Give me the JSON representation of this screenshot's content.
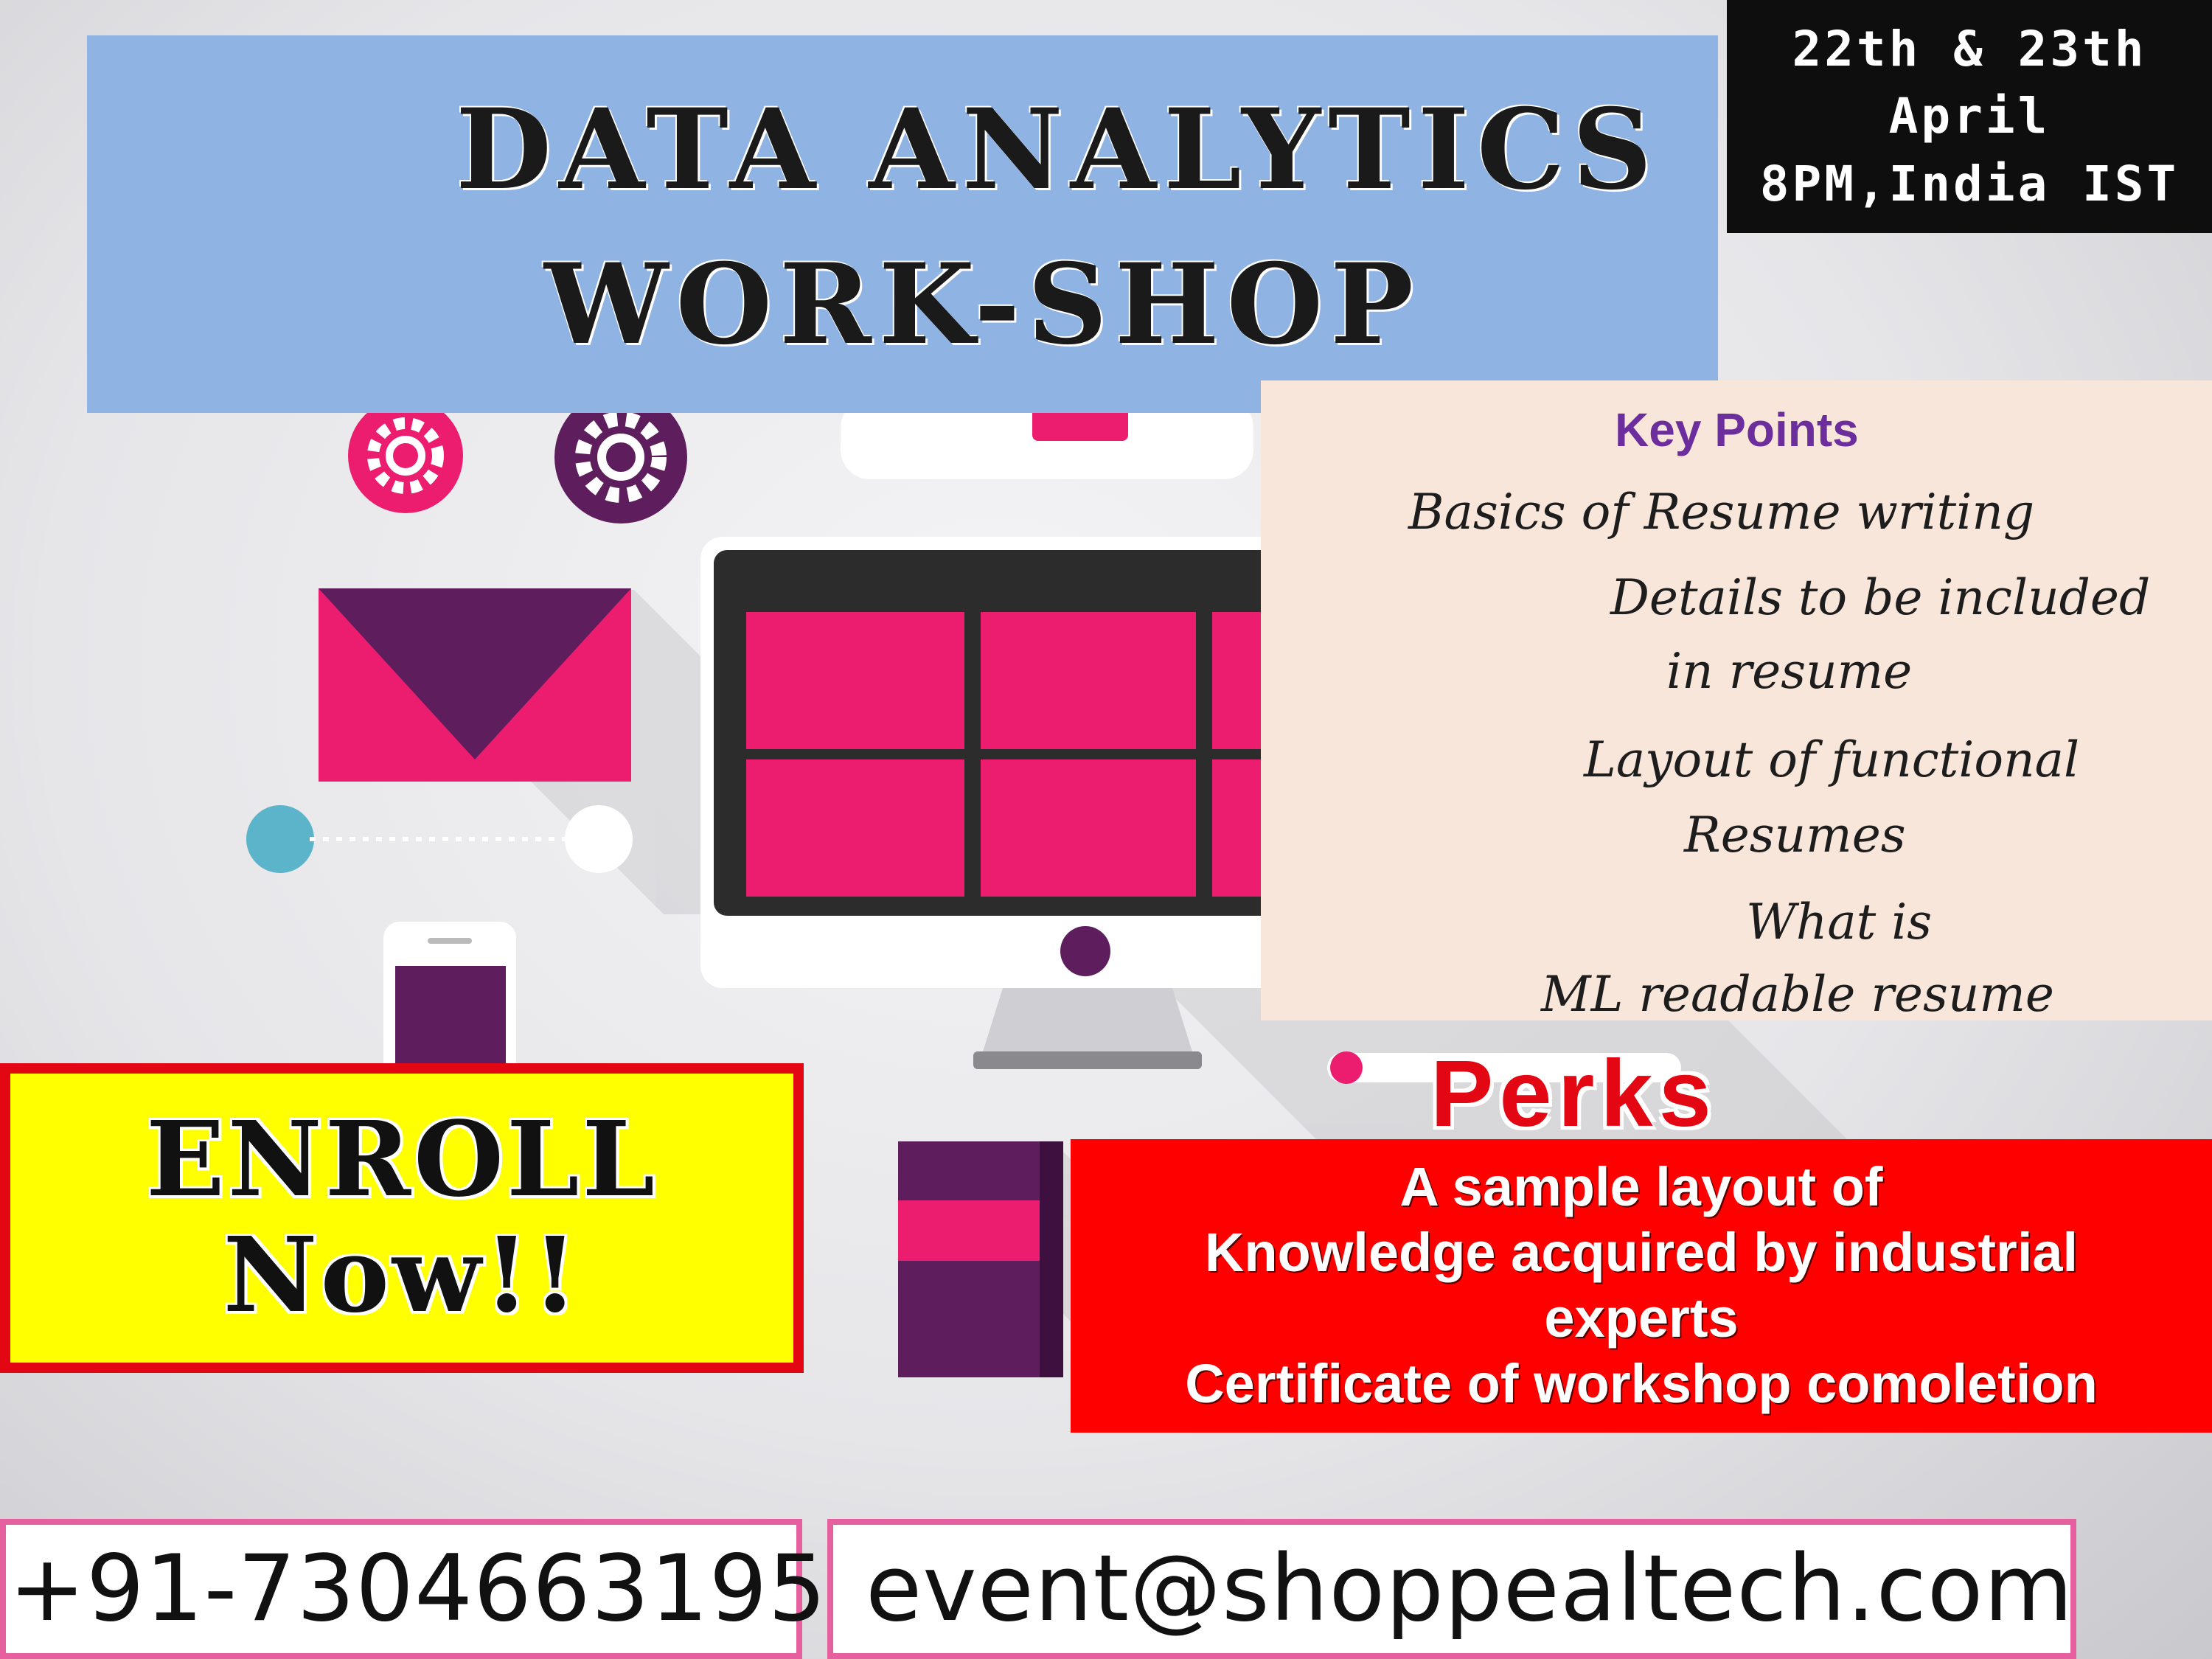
{
  "header": {
    "title_line1": "DATA ANALYTICS",
    "title_line2": "WORK-SHOP"
  },
  "schedule": {
    "dates": "22th & 23th",
    "month": "April",
    "time": "8PM,India IST"
  },
  "key_points": {
    "heading": "Key Points",
    "items": [
      "Basics of Resume writing",
      "Details to be included",
      "in resume",
      "Layout of functional",
      "Resumes",
      "What is",
      "ML readable resume"
    ]
  },
  "enroll": {
    "line1": "ENROLL",
    "line2": "Now!!"
  },
  "perks": {
    "heading": "Perks",
    "items": [
      "A sample layout of",
      "Knowledge acquired by industrial",
      "experts",
      "Certificate of workshop comoletion"
    ]
  },
  "contact": {
    "phone": "+91-7304663195",
    "email": "event@shoppealtech.com",
    "phone_icon": "phone-icon",
    "email_icon": "envelope-icon"
  },
  "colors": {
    "title_banner": "#8fb3e3",
    "date_box": "#0e0e0e",
    "key_points_panel": "#f8e6da",
    "key_points_heading": "#6b2e9c",
    "enroll_bg": "#ffff00",
    "enroll_border": "#e30613",
    "perks_bg": "#ff0000",
    "contact_border": "#e65f9f",
    "illustration_pink": "#ec1d6f",
    "illustration_purple": "#5e1d5c"
  }
}
